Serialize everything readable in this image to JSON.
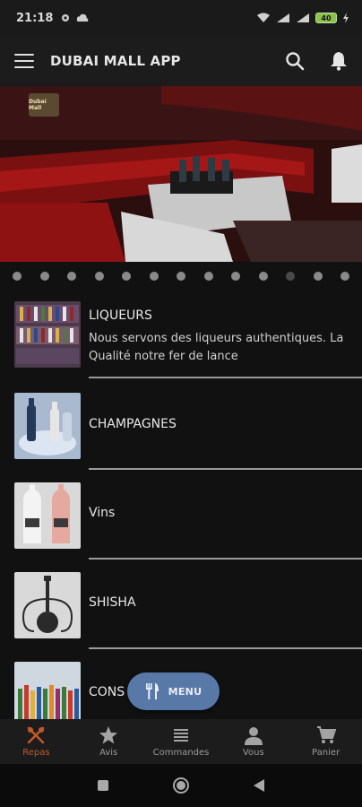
{
  "status": {
    "time": "21:18",
    "battery": "40"
  },
  "app_bar": {
    "title": "DUBAI MALL APP"
  },
  "banner": {
    "logo_text": "Dubai Mall"
  },
  "carousel": {
    "dot_count": 13,
    "active_index": 10
  },
  "items": [
    {
      "title": "LIQUEURS",
      "description": "Nous servons des liqueurs authentiques. La Qualité notre fer de lance"
    },
    {
      "title": "CHAMPAGNES",
      "description": ""
    },
    {
      "title": "Vins",
      "description": ""
    },
    {
      "title": "SHISHA",
      "description": ""
    },
    {
      "title": "CONS",
      "description": ""
    }
  ],
  "fab": {
    "label": "MENU"
  },
  "bottom_nav": [
    {
      "label": "Repas",
      "icon": "fork-knife-icon",
      "active": true
    },
    {
      "label": "Avis",
      "icon": "star-icon",
      "active": false
    },
    {
      "label": "Commandes",
      "icon": "list-icon",
      "active": false
    },
    {
      "label": "Vous",
      "icon": "person-icon",
      "active": false
    },
    {
      "label": "Panier",
      "icon": "cart-icon",
      "active": false
    }
  ],
  "colors": {
    "accent": "#c0582a",
    "fab": "#5879a8",
    "background": "#111111"
  }
}
